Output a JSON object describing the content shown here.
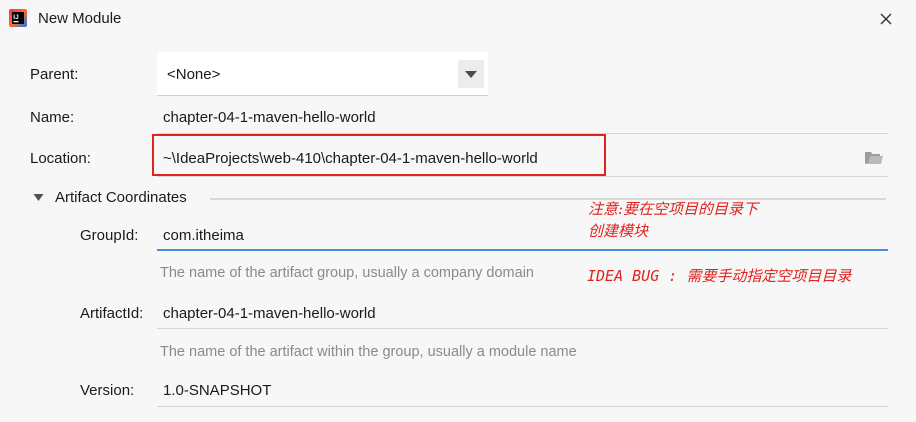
{
  "window": {
    "title": "New Module"
  },
  "form": {
    "parent_label": "Parent:",
    "parent_value": "<None>",
    "name_label": "Name:",
    "name_value": "chapter-04-1-maven-hello-world",
    "location_label": "Location:",
    "location_value": "~\\IdeaProjects\\web-410\\chapter-04-1-maven-hello-world",
    "section_title": "Artifact Coordinates",
    "groupid_label": "GroupId:",
    "groupid_value": "com.itheima",
    "groupid_hint": "The name of the artifact group, usually a company domain",
    "artifactid_label": "ArtifactId:",
    "artifactid_value": "chapter-04-1-maven-hello-world",
    "artifactid_hint": "The name of the artifact within the group, usually a module name",
    "version_label": "Version:",
    "version_value": "1.0-SNAPSHOT"
  },
  "annotations": {
    "note_line1": "注意:要在空项目的目录下",
    "note_line2": "创建模块",
    "bug_note": "IDEA BUG :  需要手动指定空项目目录"
  },
  "icons": {
    "app": "intellij-idea-icon",
    "close": "close-icon",
    "dropdown": "chevron-down-icon",
    "folder": "folder-icon",
    "collapse": "triangle-down-icon"
  },
  "colors": {
    "background": "#f7f7f7",
    "accent_underline": "#4a8fd9",
    "annotation_red": "#e0231f",
    "hint_gray": "#8a8a8a"
  }
}
